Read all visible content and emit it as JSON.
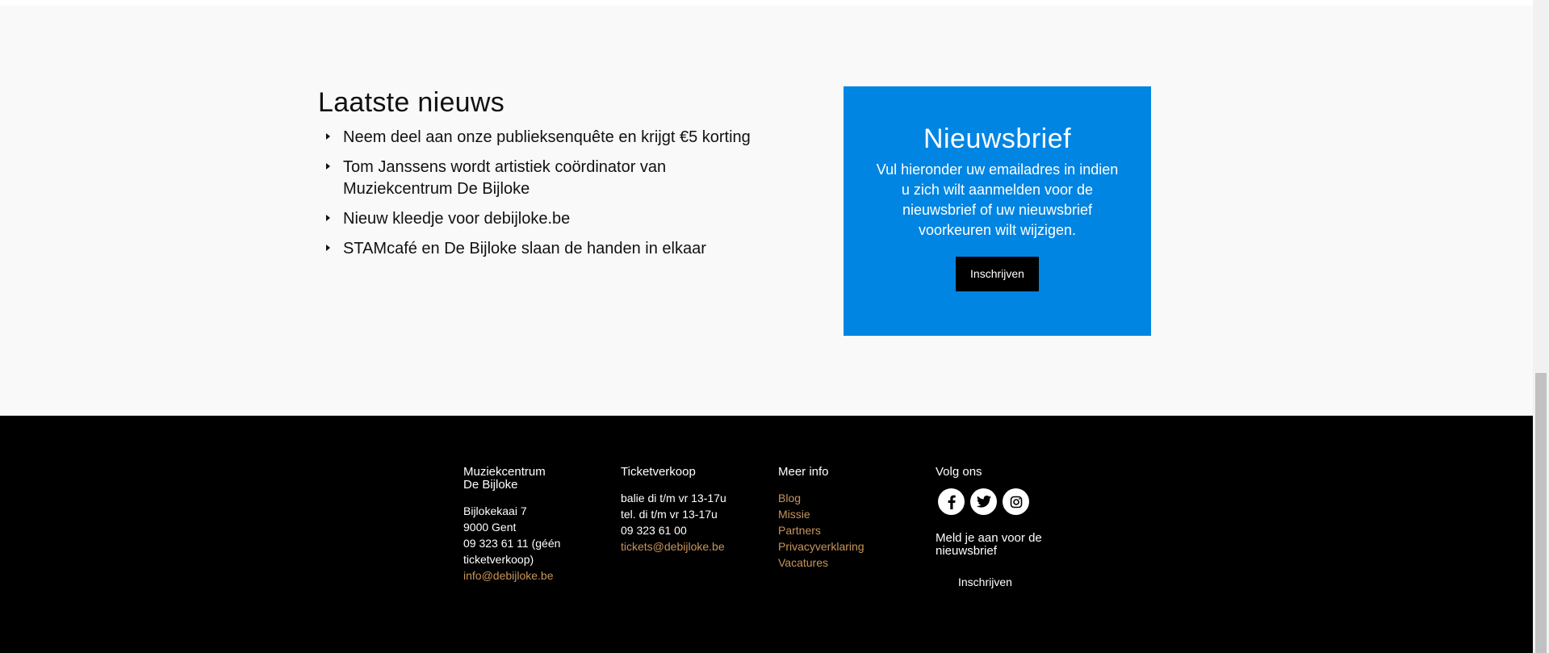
{
  "news": {
    "title": "Laatste nieuws",
    "items": [
      {
        "label": "Neem deel aan onze publieksenquête en krijgt €5 korting"
      },
      {
        "label": "Tom Janssens wordt artistiek coördinator van Muziekcentrum De Bijloke"
      },
      {
        "label": "Nieuw kleedje voor debijloke.be"
      },
      {
        "label": "STAMcafé en De Bijloke slaan de handen in elkaar"
      }
    ]
  },
  "newsletter": {
    "title": "Nieuwsbrief",
    "text": "Vul hieronder uw emailadres in indien u zich wilt aanmelden voor de nieuwsbrief of uw nieuwsbrief voorkeuren wilt wijzigen.",
    "button": "Inschrijven",
    "color": "#0085e3"
  },
  "footer": {
    "col1": {
      "title_line1": "Muziekcentrum",
      "title_line2": "De Bijloke",
      "lines": [
        "Bijlokekaai 7",
        "9000 Gent",
        "09 323 61 11 (géén",
        "ticketverkoop)"
      ],
      "email": "info@debijloke.be"
    },
    "col2": {
      "title": "Ticketverkoop",
      "lines": [
        "balie di t/m vr 13-17u",
        "tel. di t/m vr 13-17u",
        "09 323 61 00"
      ],
      "email": "tickets@debijloke.be"
    },
    "col3": {
      "title": "Meer info",
      "links": [
        "Blog",
        "Missie",
        "Partners",
        "Privacyverklaring",
        "Vacatures"
      ]
    },
    "col4": {
      "title": "Volg ons",
      "social": [
        "facebook-icon",
        "twitter-icon",
        "instagram-icon"
      ],
      "meld_line1": "Meld je aan voor de",
      "meld_line2": "nieuwsbrief",
      "button": "Inschrijven"
    },
    "link_color": "#c8955a"
  }
}
